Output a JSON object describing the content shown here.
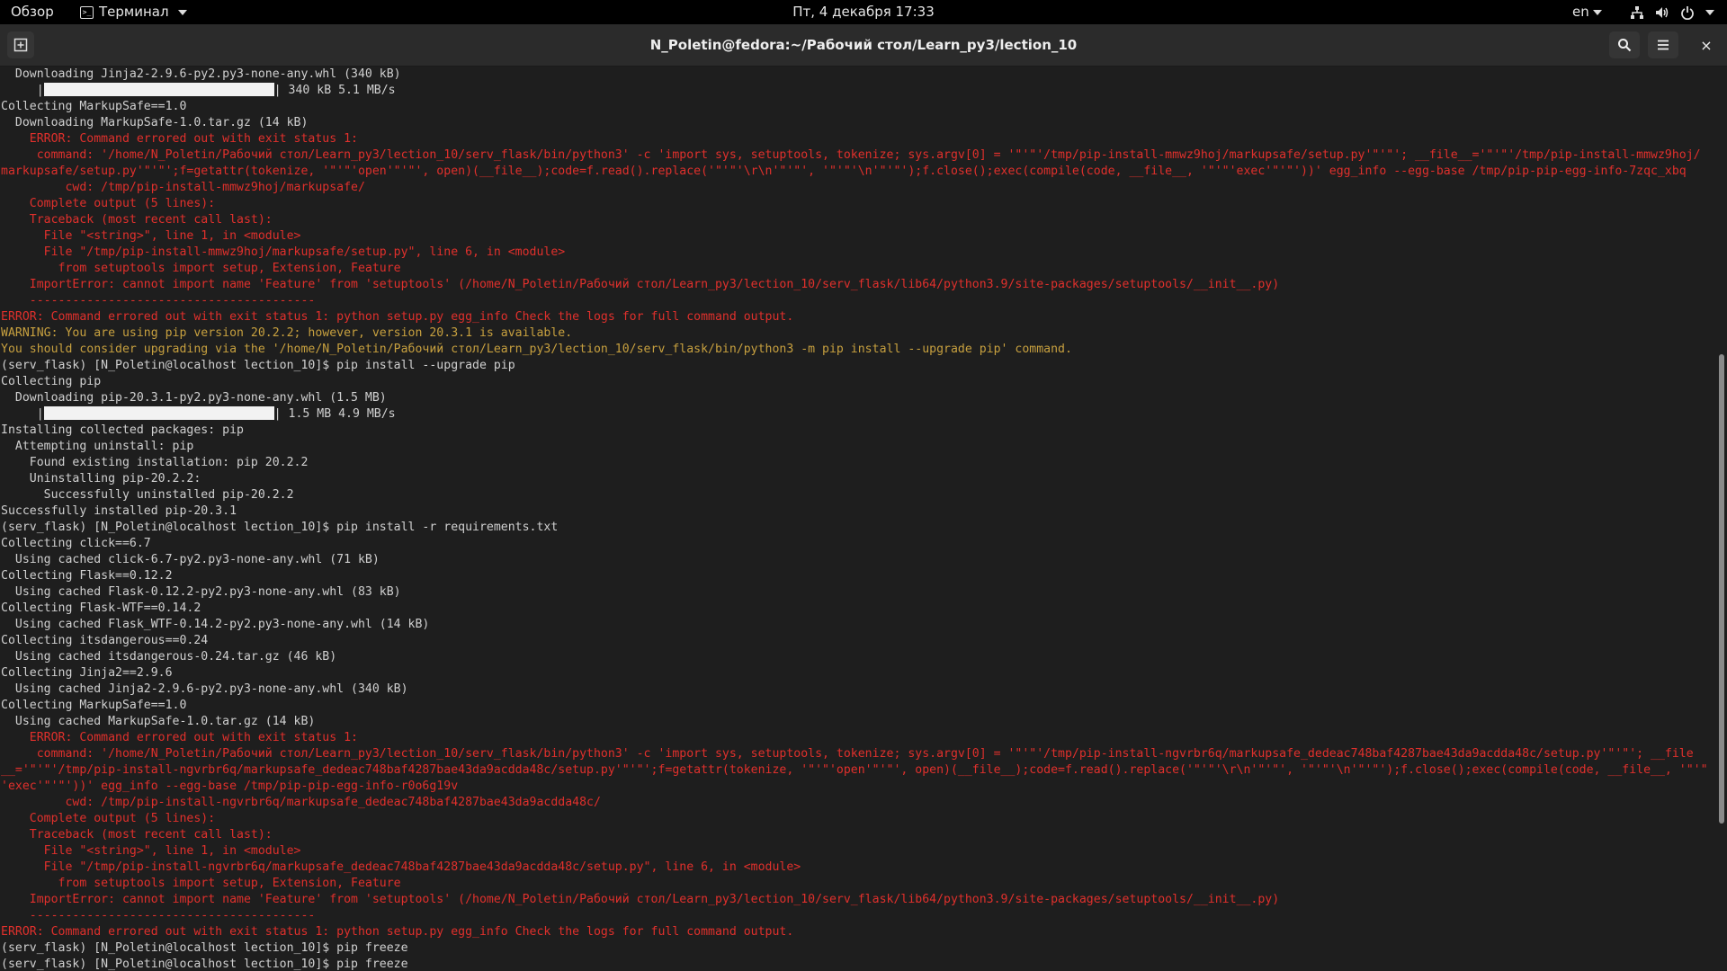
{
  "topbar": {
    "activities": "Обзор",
    "app_menu": "Терминал",
    "clock": "Пт, 4 декабря  17:33",
    "language": "en"
  },
  "window": {
    "title": "N_Poletin@fedora:~/Рабочий стол/Learn_py3/lection_10",
    "new_tab_icon": "new-tab-icon",
    "search_icon": "search-icon",
    "menu_icon": "hamburger-menu-icon",
    "close_label": "×"
  },
  "colors": {
    "error": "#e0302c",
    "warning": "#c7a03f",
    "text": "#d0d0d0",
    "background": "#1e1e1e"
  },
  "terminal": {
    "lines": [
      {
        "text": "  Downloading Jinja2-2.9.6-py2.py3-none-any.whl (340 kB)",
        "style": "normal"
      },
      {
        "text": "     |",
        "bar": true,
        "after": "| 340 kB 5.1 MB/s",
        "style": "normal"
      },
      {
        "text": "Collecting MarkupSafe==1.0",
        "style": "normal"
      },
      {
        "text": "  Downloading MarkupSafe-1.0.tar.gz (14 kB)",
        "style": "normal"
      },
      {
        "text": "    ERROR: Command errored out with exit status 1:",
        "style": "err"
      },
      {
        "text": "     command: '/home/N_Poletin/Рабочий стол/Learn_py3/lection_10/serv_flask/bin/python3' -c 'import sys, setuptools, tokenize; sys.argv[0] = '\"'\"'/tmp/pip-install-mmwz9hoj/markupsafe/setup.py'\"'\"'; __file__='\"'\"'/tmp/pip-install-mmwz9hoj/",
        "style": "err"
      },
      {
        "text": "markupsafe/setup.py'\"'\"';f=getattr(tokenize, '\"'\"'open'\"'\"', open)(__file__);code=f.read().replace('\"'\"'\\r\\n'\"'\"', '\"'\"'\\n'\"'\"');f.close();exec(compile(code, __file__, '\"'\"'exec'\"'\"'))' egg_info --egg-base /tmp/pip-pip-egg-info-7zqc_xbq",
        "style": "err"
      },
      {
        "text": "         cwd: /tmp/pip-install-mmwz9hoj/markupsafe/",
        "style": "err"
      },
      {
        "text": "    Complete output (5 lines):",
        "style": "err"
      },
      {
        "text": "    Traceback (most recent call last):",
        "style": "err"
      },
      {
        "text": "      File \"<string>\", line 1, in <module>",
        "style": "err"
      },
      {
        "text": "      File \"/tmp/pip-install-mmwz9hoj/markupsafe/setup.py\", line 6, in <module>",
        "style": "err"
      },
      {
        "text": "        from setuptools import setup, Extension, Feature",
        "style": "err"
      },
      {
        "text": "    ImportError: cannot import name 'Feature' from 'setuptools' (/home/N_Poletin/Рабочий стол/Learn_py3/lection_10/serv_flask/lib64/python3.9/site-packages/setuptools/__init__.py)",
        "style": "err"
      },
      {
        "text": "    ----------------------------------------",
        "style": "err"
      },
      {
        "text": "ERROR: Command errored out with exit status 1: python setup.py egg_info Check the logs for full command output.",
        "style": "err"
      },
      {
        "text": "WARNING: You are using pip version 20.2.2; however, version 20.3.1 is available.",
        "style": "warn"
      },
      {
        "text": "You should consider upgrading via the '/home/N_Poletin/Рабочий стол/Learn_py3/lection_10/serv_flask/bin/python3 -m pip install --upgrade pip' command.",
        "style": "warn"
      },
      {
        "text": "(serv_flask) [N_Poletin@localhost lection_10]$ pip install --upgrade pip",
        "style": "normal"
      },
      {
        "text": "Collecting pip",
        "style": "normal"
      },
      {
        "text": "  Downloading pip-20.3.1-py2.py3-none-any.whl (1.5 MB)",
        "style": "normal"
      },
      {
        "text": "     |",
        "bar": true,
        "after": "| 1.5 MB 4.9 MB/s",
        "style": "normal"
      },
      {
        "text": "Installing collected packages: pip",
        "style": "normal"
      },
      {
        "text": "  Attempting uninstall: pip",
        "style": "normal"
      },
      {
        "text": "    Found existing installation: pip 20.2.2",
        "style": "normal"
      },
      {
        "text": "    Uninstalling pip-20.2.2:",
        "style": "normal"
      },
      {
        "text": "      Successfully uninstalled pip-20.2.2",
        "style": "normal"
      },
      {
        "text": "Successfully installed pip-20.3.1",
        "style": "normal"
      },
      {
        "text": "(serv_flask) [N_Poletin@localhost lection_10]$ pip install -r requirements.txt",
        "style": "normal"
      },
      {
        "text": "Collecting click==6.7",
        "style": "normal"
      },
      {
        "text": "  Using cached click-6.7-py2.py3-none-any.whl (71 kB)",
        "style": "normal"
      },
      {
        "text": "Collecting Flask==0.12.2",
        "style": "normal"
      },
      {
        "text": "  Using cached Flask-0.12.2-py2.py3-none-any.whl (83 kB)",
        "style": "normal"
      },
      {
        "text": "Collecting Flask-WTF==0.14.2",
        "style": "normal"
      },
      {
        "text": "  Using cached Flask_WTF-0.14.2-py2.py3-none-any.whl (14 kB)",
        "style": "normal"
      },
      {
        "text": "Collecting itsdangerous==0.24",
        "style": "normal"
      },
      {
        "text": "  Using cached itsdangerous-0.24.tar.gz (46 kB)",
        "style": "normal"
      },
      {
        "text": "Collecting Jinja2==2.9.6",
        "style": "normal"
      },
      {
        "text": "  Using cached Jinja2-2.9.6-py2.py3-none-any.whl (340 kB)",
        "style": "normal"
      },
      {
        "text": "Collecting MarkupSafe==1.0",
        "style": "normal"
      },
      {
        "text": "  Using cached MarkupSafe-1.0.tar.gz (14 kB)",
        "style": "normal"
      },
      {
        "text": "    ERROR: Command errored out with exit status 1:",
        "style": "err"
      },
      {
        "text": "     command: '/home/N_Poletin/Рабочий стол/Learn_py3/lection_10/serv_flask/bin/python3' -c 'import sys, setuptools, tokenize; sys.argv[0] = '\"'\"'/tmp/pip-install-ngvrbr6q/markupsafe_dedeac748baf4287bae43da9acdda48c/setup.py'\"'\"'; __file",
        "style": "err"
      },
      {
        "text": "__='\"'\"'/tmp/pip-install-ngvrbr6q/markupsafe_dedeac748baf4287bae43da9acdda48c/setup.py'\"'\"';f=getattr(tokenize, '\"'\"'open'\"'\"', open)(__file__);code=f.read().replace('\"'\"'\\r\\n'\"'\"', '\"'\"'\\n'\"'\"');f.close();exec(compile(code, __file__, '\"'\"",
        "style": "err"
      },
      {
        "text": "'exec'\"'\"'))' egg_info --egg-base /tmp/pip-pip-egg-info-r0o6g19v",
        "style": "err"
      },
      {
        "text": "         cwd: /tmp/pip-install-ngvrbr6q/markupsafe_dedeac748baf4287bae43da9acdda48c/",
        "style": "err"
      },
      {
        "text": "    Complete output (5 lines):",
        "style": "err"
      },
      {
        "text": "    Traceback (most recent call last):",
        "style": "err"
      },
      {
        "text": "      File \"<string>\", line 1, in <module>",
        "style": "err"
      },
      {
        "text": "      File \"/tmp/pip-install-ngvrbr6q/markupsafe_dedeac748baf4287bae43da9acdda48c/setup.py\", line 6, in <module>",
        "style": "err"
      },
      {
        "text": "        from setuptools import setup, Extension, Feature",
        "style": "err"
      },
      {
        "text": "    ImportError: cannot import name 'Feature' from 'setuptools' (/home/N_Poletin/Рабочий стол/Learn_py3/lection_10/serv_flask/lib64/python3.9/site-packages/setuptools/__init__.py)",
        "style": "err"
      },
      {
        "text": "    ----------------------------------------",
        "style": "err"
      },
      {
        "text": "ERROR: Command errored out with exit status 1: python setup.py egg_info Check the logs for full command output.",
        "style": "err"
      },
      {
        "text": "(serv_flask) [N_Poletin@localhost lection_10]$ pip freeze",
        "style": "normal"
      },
      {
        "text": "(serv_flask) [N_Poletin@localhost lection_10]$ pip freeze",
        "style": "normal"
      }
    ]
  }
}
